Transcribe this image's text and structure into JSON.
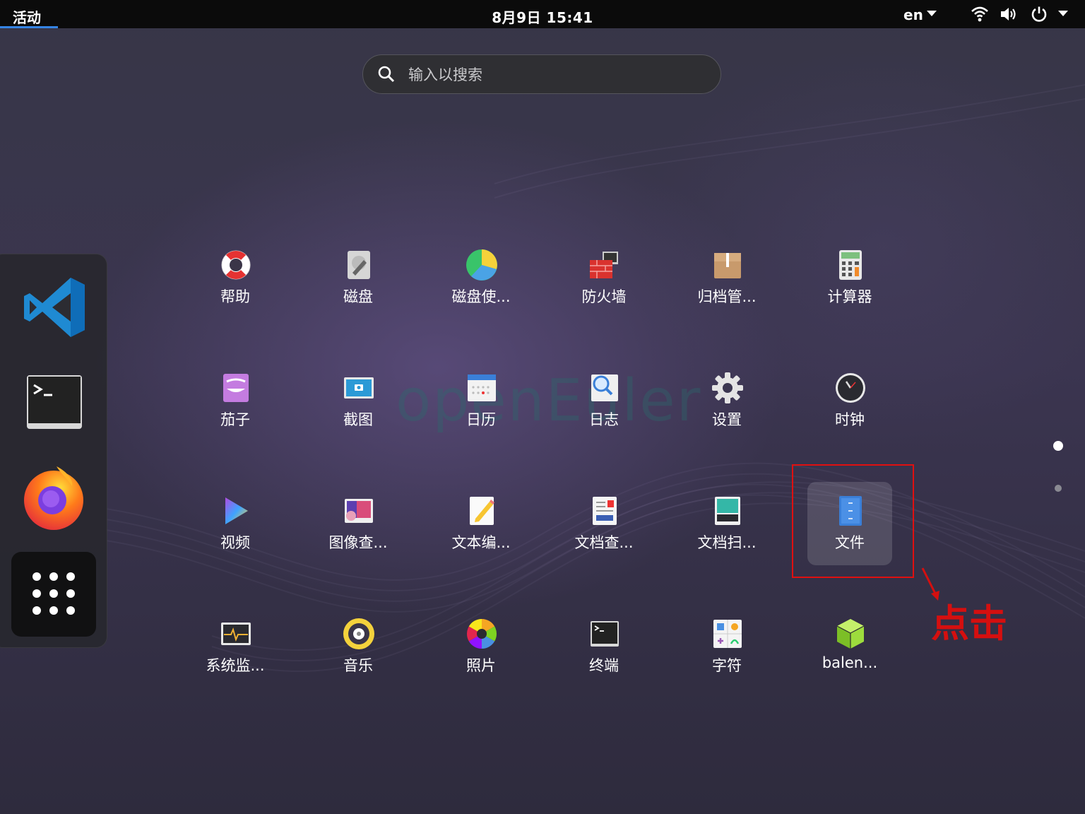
{
  "topbar": {
    "activities": "活动",
    "clock": "8月9日  15:41",
    "language": "en"
  },
  "search": {
    "placeholder": "输入以搜索"
  },
  "watermark": "openEuler",
  "dock": {
    "items": [
      "vscode-icon",
      "terminal-icon",
      "firefox-icon",
      "show-apps-icon"
    ]
  },
  "apps": [
    {
      "label": "帮助",
      "icon": "lifebuoy-icon"
    },
    {
      "label": "磁盘",
      "icon": "disk-utility-icon"
    },
    {
      "label": "磁盘使...",
      "icon": "disk-usage-icon"
    },
    {
      "label": "防火墙",
      "icon": "firewall-icon"
    },
    {
      "label": "归档管...",
      "icon": "archive-manager-icon"
    },
    {
      "label": "计算器",
      "icon": "calculator-icon"
    },
    {
      "label": "茄子",
      "icon": "cheese-icon"
    },
    {
      "label": "截图",
      "icon": "screenshot-icon"
    },
    {
      "label": "日历",
      "icon": "calendar-icon"
    },
    {
      "label": "日志",
      "icon": "logs-icon"
    },
    {
      "label": "设置",
      "icon": "settings-gear-icon"
    },
    {
      "label": "时钟",
      "icon": "clock-icon"
    },
    {
      "label": "视频",
      "icon": "video-player-icon"
    },
    {
      "label": "图像查...",
      "icon": "image-viewer-icon"
    },
    {
      "label": "文本编...",
      "icon": "text-editor-icon"
    },
    {
      "label": "文档查...",
      "icon": "document-viewer-icon"
    },
    {
      "label": "文档扫...",
      "icon": "document-scanner-icon"
    },
    {
      "label": "文件",
      "icon": "files-icon"
    },
    {
      "label": "系统监...",
      "icon": "system-monitor-icon"
    },
    {
      "label": "音乐",
      "icon": "music-icon"
    },
    {
      "label": "照片",
      "icon": "photos-icon"
    },
    {
      "label": "终端",
      "icon": "terminal-app-icon"
    },
    {
      "label": "字符",
      "icon": "characters-icon"
    },
    {
      "label": "balen...",
      "icon": "balena-etcher-icon"
    }
  ],
  "annotation": {
    "text": "点击",
    "color": "#d50f0f"
  },
  "page_indicator": {
    "pages": 2,
    "current": 1
  }
}
